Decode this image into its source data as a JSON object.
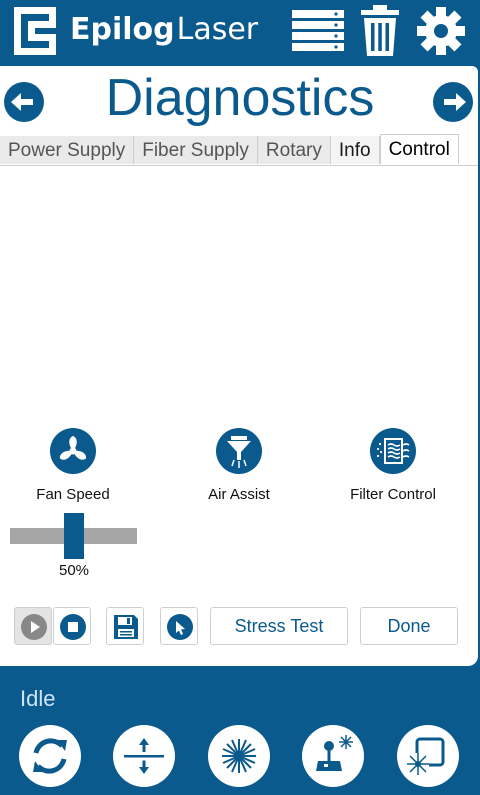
{
  "header": {
    "brand_bold": "Epilog",
    "brand_light": "Laser",
    "icons": [
      "list-icon",
      "trash-icon",
      "gear-icon"
    ]
  },
  "page": {
    "title": "Diagnostics",
    "prev_icon": "arrow-left-icon",
    "next_icon": "arrow-right-icon"
  },
  "tabs": [
    {
      "label": "Power Supply",
      "state": "inactive"
    },
    {
      "label": "Fiber Supply",
      "state": "inactive"
    },
    {
      "label": "Rotary",
      "state": "inactive"
    },
    {
      "label": "Info",
      "state": "inactive-light"
    },
    {
      "label": "Control",
      "state": "active"
    }
  ],
  "controls": {
    "fan": {
      "label": "Fan Speed",
      "icon": "fan-icon"
    },
    "air": {
      "label": "Air Assist",
      "icon": "nozzle-icon"
    },
    "filter": {
      "label": "Filter Control",
      "icon": "filter-icon"
    },
    "fan_speed": {
      "value": 0.5,
      "display": "50%"
    }
  },
  "toolbar": {
    "play_icon": "play-icon",
    "stop_icon": "stop-icon",
    "save_icon": "save-icon",
    "pointer_icon": "pointer-icon",
    "stress_test_label": "Stress Test",
    "done_label": "Done"
  },
  "footer": {
    "status": "Idle",
    "buttons": [
      "refresh-icon",
      "focus-icon",
      "laser-icon",
      "joystick-icon",
      "frame-icon"
    ]
  },
  "colors": {
    "brand": "#0b5a8e",
    "background": "#ffffff",
    "disabled": "#888888"
  }
}
